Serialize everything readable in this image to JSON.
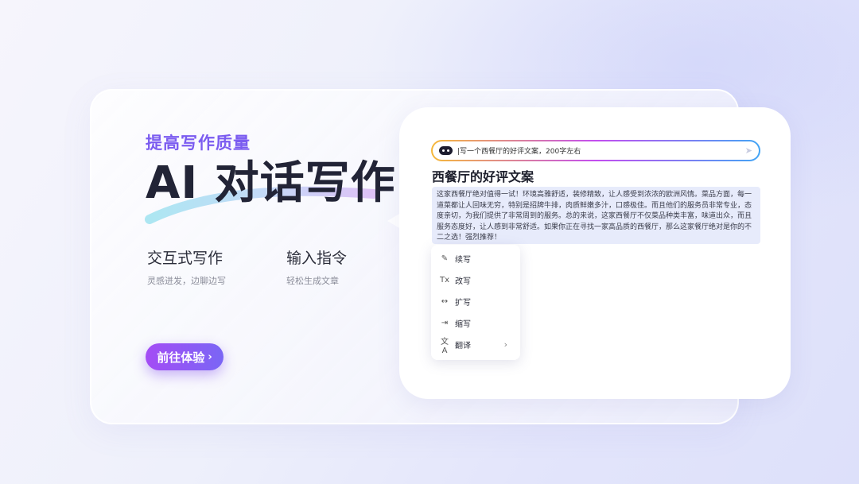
{
  "subtitle": "提高写作质量",
  "title": "AI 对话写作",
  "features": [
    {
      "title": "交互式写作",
      "sub": "灵感迸发，边聊边写"
    },
    {
      "title": "输入指令",
      "sub": "轻松生成文章"
    }
  ],
  "cta": {
    "label": "前往体验",
    "chevron": "›"
  },
  "prompt": {
    "text": "|写一个西餐厅的好评文案，200字左右",
    "send_icon": "send-icon"
  },
  "doc": {
    "title": "西餐厅的好评文案",
    "body": "这家西餐厅绝对值得一试！环境高雅舒适，装修精致，让人感受到浓浓的欧洲风情。菜品方面，每一道菜都让人回味无穷，特别是招牌牛排，肉质鲜嫩多汁，口感极佳。而且他们的服务员非常专业，态度亲切，为我们提供了非常周到的服务。总的来说，这家西餐厅不仅菜品种类丰富，味道出众，而且服务态度好，让人感到非常舒适。如果你正在寻找一家高品质的西餐厅，那么这家餐厅绝对是你的不二之选！强烈推荐！"
  },
  "menu": [
    {
      "label": "续写",
      "icon": "continue-write-icon",
      "glyph": "✎"
    },
    {
      "label": "改写",
      "icon": "rewrite-icon",
      "glyph": "Tx"
    },
    {
      "label": "扩写",
      "icon": "expand-icon",
      "glyph": "↔"
    },
    {
      "label": "缩写",
      "icon": "shrink-icon",
      "glyph": "⇥"
    },
    {
      "label": "翻译",
      "icon": "translate-icon",
      "glyph": "文A",
      "submenu": "›"
    }
  ],
  "colors": {
    "accent": "#7b5cf0",
    "cta_start": "#a44cf5",
    "cta_end": "#7a66f5",
    "doc_bg": "#e7ebfb"
  }
}
